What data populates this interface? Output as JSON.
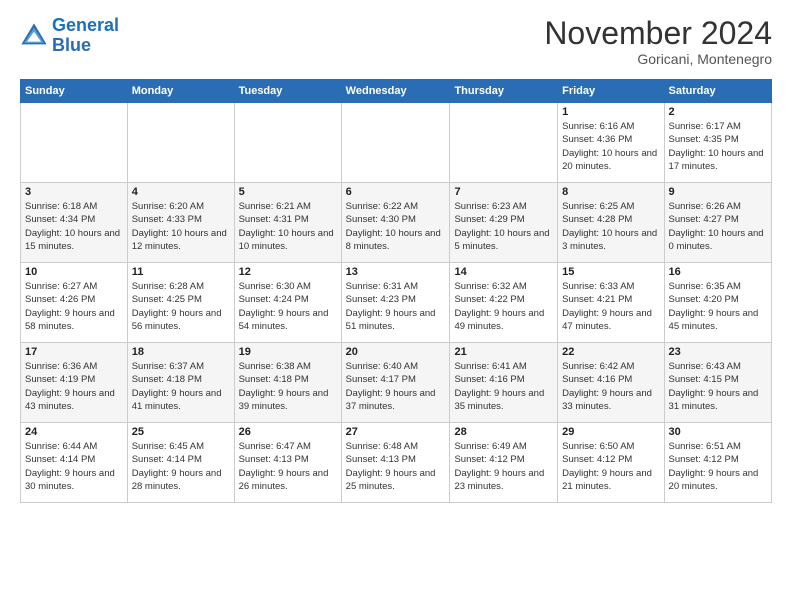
{
  "logo": {
    "line1": "General",
    "line2": "Blue"
  },
  "title": "November 2024",
  "subtitle": "Goricani, Montenegro",
  "days_header": [
    "Sunday",
    "Monday",
    "Tuesday",
    "Wednesday",
    "Thursday",
    "Friday",
    "Saturday"
  ],
  "weeks": [
    [
      {
        "day": "",
        "info": ""
      },
      {
        "day": "",
        "info": ""
      },
      {
        "day": "",
        "info": ""
      },
      {
        "day": "",
        "info": ""
      },
      {
        "day": "",
        "info": ""
      },
      {
        "day": "1",
        "info": "Sunrise: 6:16 AM\nSunset: 4:36 PM\nDaylight: 10 hours and 20 minutes."
      },
      {
        "day": "2",
        "info": "Sunrise: 6:17 AM\nSunset: 4:35 PM\nDaylight: 10 hours and 17 minutes."
      }
    ],
    [
      {
        "day": "3",
        "info": "Sunrise: 6:18 AM\nSunset: 4:34 PM\nDaylight: 10 hours and 15 minutes."
      },
      {
        "day": "4",
        "info": "Sunrise: 6:20 AM\nSunset: 4:33 PM\nDaylight: 10 hours and 12 minutes."
      },
      {
        "day": "5",
        "info": "Sunrise: 6:21 AM\nSunset: 4:31 PM\nDaylight: 10 hours and 10 minutes."
      },
      {
        "day": "6",
        "info": "Sunrise: 6:22 AM\nSunset: 4:30 PM\nDaylight: 10 hours and 8 minutes."
      },
      {
        "day": "7",
        "info": "Sunrise: 6:23 AM\nSunset: 4:29 PM\nDaylight: 10 hours and 5 minutes."
      },
      {
        "day": "8",
        "info": "Sunrise: 6:25 AM\nSunset: 4:28 PM\nDaylight: 10 hours and 3 minutes."
      },
      {
        "day": "9",
        "info": "Sunrise: 6:26 AM\nSunset: 4:27 PM\nDaylight: 10 hours and 0 minutes."
      }
    ],
    [
      {
        "day": "10",
        "info": "Sunrise: 6:27 AM\nSunset: 4:26 PM\nDaylight: 9 hours and 58 minutes."
      },
      {
        "day": "11",
        "info": "Sunrise: 6:28 AM\nSunset: 4:25 PM\nDaylight: 9 hours and 56 minutes."
      },
      {
        "day": "12",
        "info": "Sunrise: 6:30 AM\nSunset: 4:24 PM\nDaylight: 9 hours and 54 minutes."
      },
      {
        "day": "13",
        "info": "Sunrise: 6:31 AM\nSunset: 4:23 PM\nDaylight: 9 hours and 51 minutes."
      },
      {
        "day": "14",
        "info": "Sunrise: 6:32 AM\nSunset: 4:22 PM\nDaylight: 9 hours and 49 minutes."
      },
      {
        "day": "15",
        "info": "Sunrise: 6:33 AM\nSunset: 4:21 PM\nDaylight: 9 hours and 47 minutes."
      },
      {
        "day": "16",
        "info": "Sunrise: 6:35 AM\nSunset: 4:20 PM\nDaylight: 9 hours and 45 minutes."
      }
    ],
    [
      {
        "day": "17",
        "info": "Sunrise: 6:36 AM\nSunset: 4:19 PM\nDaylight: 9 hours and 43 minutes."
      },
      {
        "day": "18",
        "info": "Sunrise: 6:37 AM\nSunset: 4:18 PM\nDaylight: 9 hours and 41 minutes."
      },
      {
        "day": "19",
        "info": "Sunrise: 6:38 AM\nSunset: 4:18 PM\nDaylight: 9 hours and 39 minutes."
      },
      {
        "day": "20",
        "info": "Sunrise: 6:40 AM\nSunset: 4:17 PM\nDaylight: 9 hours and 37 minutes."
      },
      {
        "day": "21",
        "info": "Sunrise: 6:41 AM\nSunset: 4:16 PM\nDaylight: 9 hours and 35 minutes."
      },
      {
        "day": "22",
        "info": "Sunrise: 6:42 AM\nSunset: 4:16 PM\nDaylight: 9 hours and 33 minutes."
      },
      {
        "day": "23",
        "info": "Sunrise: 6:43 AM\nSunset: 4:15 PM\nDaylight: 9 hours and 31 minutes."
      }
    ],
    [
      {
        "day": "24",
        "info": "Sunrise: 6:44 AM\nSunset: 4:14 PM\nDaylight: 9 hours and 30 minutes."
      },
      {
        "day": "25",
        "info": "Sunrise: 6:45 AM\nSunset: 4:14 PM\nDaylight: 9 hours and 28 minutes."
      },
      {
        "day": "26",
        "info": "Sunrise: 6:47 AM\nSunset: 4:13 PM\nDaylight: 9 hours and 26 minutes."
      },
      {
        "day": "27",
        "info": "Sunrise: 6:48 AM\nSunset: 4:13 PM\nDaylight: 9 hours and 25 minutes."
      },
      {
        "day": "28",
        "info": "Sunrise: 6:49 AM\nSunset: 4:12 PM\nDaylight: 9 hours and 23 minutes."
      },
      {
        "day": "29",
        "info": "Sunrise: 6:50 AM\nSunset: 4:12 PM\nDaylight: 9 hours and 21 minutes."
      },
      {
        "day": "30",
        "info": "Sunrise: 6:51 AM\nSunset: 4:12 PM\nDaylight: 9 hours and 20 minutes."
      }
    ]
  ]
}
